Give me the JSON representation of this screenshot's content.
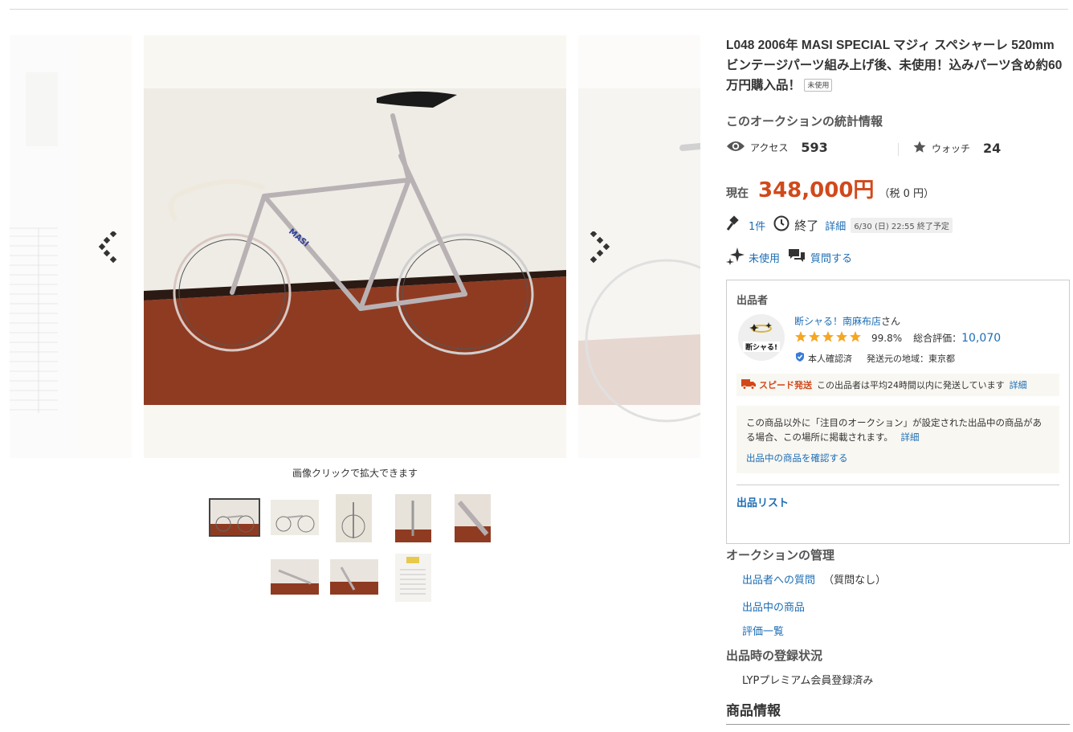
{
  "gallery": {
    "caption": "画像クリックで拡大できます",
    "thumbnail_count": 8,
    "selected_index": 0
  },
  "item": {
    "title": "L048 2006年 MASI SPECIAL マジィ スペシャーレ 520mm ビンテージパーツ組み上げ後、未使用！込みパーツ含め約60万円購入品！",
    "condition_badge": "未使用"
  },
  "stats": {
    "heading": "このオークションの統計情報",
    "access_label": "アクセス",
    "access_count": "593",
    "watch_label": "ウォッチ",
    "watch_count": "24"
  },
  "price": {
    "label": "現在",
    "value": "348,000円",
    "tax": "（税 0 円）"
  },
  "bid": {
    "count": "1件",
    "end_label": "終了",
    "detail_link": "詳細",
    "end_time": "6/30 (日) 22:55 終了予定"
  },
  "condition": {
    "label": "未使用",
    "question_link": "質問する"
  },
  "seller": {
    "heading": "出品者",
    "avatar_text": "断シャる!",
    "name": "断シャる！南麻布店",
    "name_suffix": "さん",
    "rating_stars": 5,
    "rating_percent": "99.8%",
    "total_label": "総合評価：",
    "total_value": "10,070",
    "verified": "本人確認済",
    "ship_from": "発送元の地域：東京都",
    "speed_label": "スピード発送",
    "speed_text": "この出品者は平均24時間以内に発送しています",
    "speed_detail": "詳細",
    "notice_text": "この商品以外に「注目のオークション」が設定された出品中の商品がある場合、この場所に掲載されます。",
    "notice_detail": "詳細",
    "notice_link": "出品中の商品を確認する",
    "list_link": "出品リスト"
  },
  "management": {
    "heading": "オークションの管理",
    "question_link": "出品者への質問",
    "question_status": "（質問なし）",
    "items_link": "出品中の商品",
    "reviews_link": "評価一覧"
  },
  "registration": {
    "heading": "出品時の登録状況",
    "status": "LYPプレミアム会員登録済み"
  },
  "product_info": {
    "heading": "商品情報"
  },
  "colors": {
    "price": "#d1491b",
    "link": "#1d6db4",
    "star": "#f5a623",
    "speed": "#d1491b",
    "panel_bg": "#f8f7f2"
  }
}
